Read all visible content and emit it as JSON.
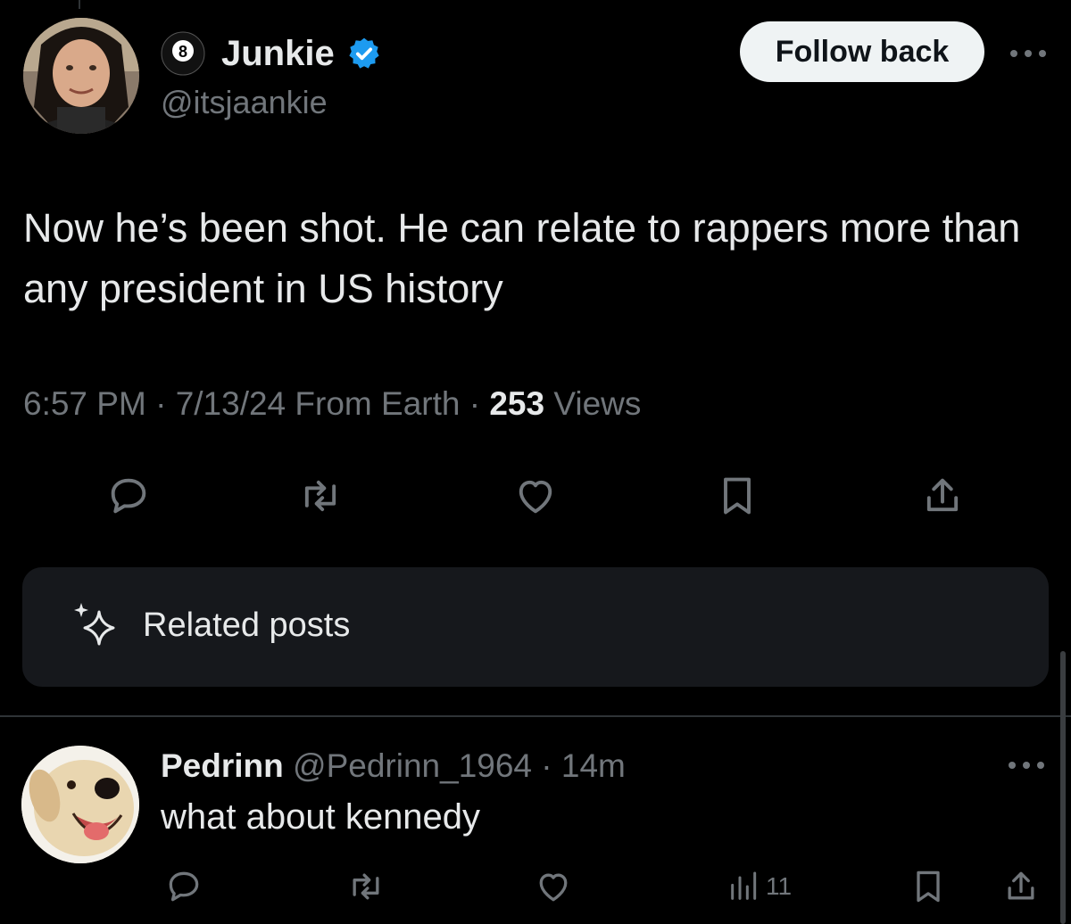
{
  "tweet": {
    "display_name": "Junkie",
    "handle": "@itsjaankie",
    "follow_label": "Follow back",
    "text": "Now he’s been shot.  He can relate to rappers more than any president in US history",
    "time": "6:57 PM",
    "date": "7/13/24",
    "source": "From Earth",
    "views_count": "253",
    "views_label": "Views",
    "icons": [
      "reply-icon",
      "retweet-icon",
      "like-icon",
      "bookmark-icon",
      "share-icon"
    ]
  },
  "related": {
    "label": "Related posts",
    "icon": "sparkle-icon"
  },
  "reply": {
    "display_name": "Pedrinn",
    "handle": "@Pedrinn_1964",
    "age": "14m",
    "text": "what about kennedy",
    "views": "11",
    "icons": [
      "reply-icon",
      "retweet-icon",
      "like-icon",
      "views-icon",
      "bookmark-icon",
      "share-icon"
    ]
  },
  "colors": {
    "background": "#000000",
    "text": "#e7e9ea",
    "secondary": "#71767b",
    "verified": "#1d9bf0",
    "button_bg": "#eff3f4",
    "card_bg": "#16181c"
  }
}
